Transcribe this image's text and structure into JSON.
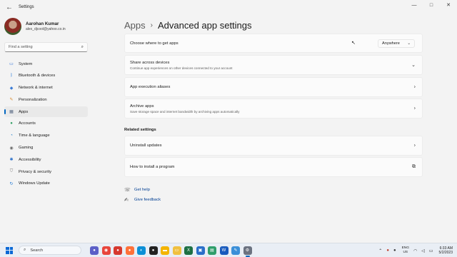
{
  "window": {
    "title": "Settings",
    "controls": [
      "—",
      "□",
      "✕"
    ]
  },
  "profile": {
    "name": "Aarohan Kumar",
    "email": "alex_djcool@yahoo.co.in"
  },
  "search": {
    "placeholder": "Find a setting"
  },
  "nav": [
    {
      "label": "System",
      "icon": "system-icon",
      "glyph": "▭",
      "color": "#2d6fd6"
    },
    {
      "label": "Bluetooth & devices",
      "icon": "bluetooth-icon",
      "glyph": "ᛒ",
      "color": "#1f74d8"
    },
    {
      "label": "Network & internet",
      "icon": "network-icon",
      "glyph": "◆",
      "color": "#3a7bd5"
    },
    {
      "label": "Personalization",
      "icon": "personalization-icon",
      "glyph": "✎",
      "color": "#d88a2d"
    },
    {
      "label": "Apps",
      "icon": "apps-icon",
      "glyph": "▦",
      "color": "#5a6b85"
    },
    {
      "label": "Accounts",
      "icon": "accounts-icon",
      "glyph": "●",
      "color": "#2f9e63"
    },
    {
      "label": "Time & language",
      "icon": "time-language-icon",
      "glyph": "◔",
      "color": "#2a83c9"
    },
    {
      "label": "Gaming",
      "icon": "gaming-icon",
      "glyph": "◉",
      "color": "#6b6b6b"
    },
    {
      "label": "Accessibility",
      "icon": "accessibility-icon",
      "glyph": "✱",
      "color": "#2a6fc9"
    },
    {
      "label": "Privacy & security",
      "icon": "privacy-icon",
      "glyph": "⛉",
      "color": "#7a7a7a"
    },
    {
      "label": "Windows Update",
      "icon": "windows-update-icon",
      "glyph": "↻",
      "color": "#1e78d4"
    }
  ],
  "active_nav": "Apps",
  "breadcrumb": {
    "parent": "Apps",
    "separator": "›",
    "current": "Advanced app settings"
  },
  "cards": {
    "get_apps": {
      "title": "Choose where to get apps",
      "value": "Anywhere"
    },
    "share": {
      "title": "Share across devices",
      "subtitle": "Continue app experiences on other devices connected to your account"
    },
    "aliases": {
      "title": "App execution aliases"
    },
    "archive": {
      "title": "Archive apps",
      "subtitle": "Save storage space and internet bandwidth by archiving apps automatically"
    }
  },
  "related": {
    "heading": "Related settings",
    "uninstall": "Uninstall updates",
    "install_program": "How to install a program"
  },
  "links": {
    "help": "Get help",
    "feedback": "Give feedback"
  },
  "taskbar": {
    "search_label": "Search",
    "apps": [
      {
        "name": "chat-app",
        "color": "#5b5fc7",
        "glyph": "●"
      },
      {
        "name": "chrome-app",
        "color": "#e8453c",
        "glyph": "◉"
      },
      {
        "name": "app-red",
        "color": "#d6382f",
        "glyph": "●"
      },
      {
        "name": "firefox-app",
        "color": "#ff7139",
        "glyph": "●"
      },
      {
        "name": "edge-app",
        "color": "#0c8fd6",
        "glyph": "◐"
      },
      {
        "name": "app-dark",
        "color": "#222222",
        "glyph": "●"
      },
      {
        "name": "files-app",
        "color": "#f4b400",
        "glyph": "▬"
      },
      {
        "name": "explorer-app",
        "color": "#f0c040",
        "glyph": "▭"
      },
      {
        "name": "excel-app",
        "color": "#1d7044",
        "glyph": "X"
      },
      {
        "name": "store-app",
        "color": "#2a6fc9",
        "glyph": "▣"
      },
      {
        "name": "notes-app",
        "color": "#2e9e6b",
        "glyph": "▤"
      },
      {
        "name": "word-app",
        "color": "#185abd",
        "glyph": "W"
      },
      {
        "name": "paint-app",
        "color": "#3a8fd8",
        "glyph": "✎"
      },
      {
        "name": "settings-app",
        "color": "#6b7280",
        "glyph": "⚙"
      }
    ],
    "language": {
      "line1": "ENG",
      "line2": "US"
    },
    "time": "6:33 AM",
    "date": "5/2/2023"
  }
}
